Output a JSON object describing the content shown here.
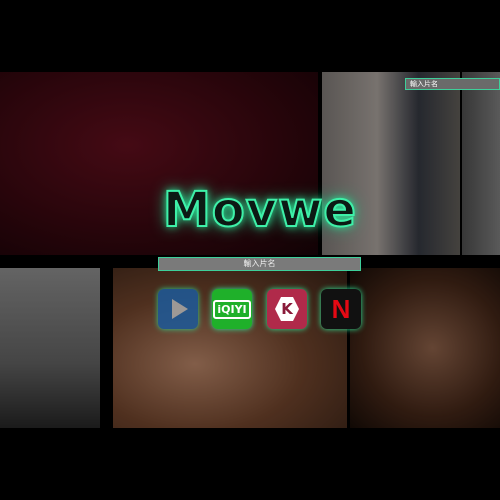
{
  "logo": {
    "text": "Movwe"
  },
  "top_search": {
    "placeholder": "輸入片名"
  },
  "search": {
    "placeholder": "輸入片名"
  },
  "apps": [
    {
      "name": "video-player",
      "icon": "play-icon",
      "color": "#1d5a9a"
    },
    {
      "name": "iQIYI",
      "label": "iQIYI",
      "color": "#1fb02a"
    },
    {
      "name": "KKTV",
      "label": "K",
      "color": "#b02a4a"
    },
    {
      "name": "Netflix",
      "label": "N",
      "color": "#e50914"
    }
  ],
  "accent": "#3ef0a8"
}
